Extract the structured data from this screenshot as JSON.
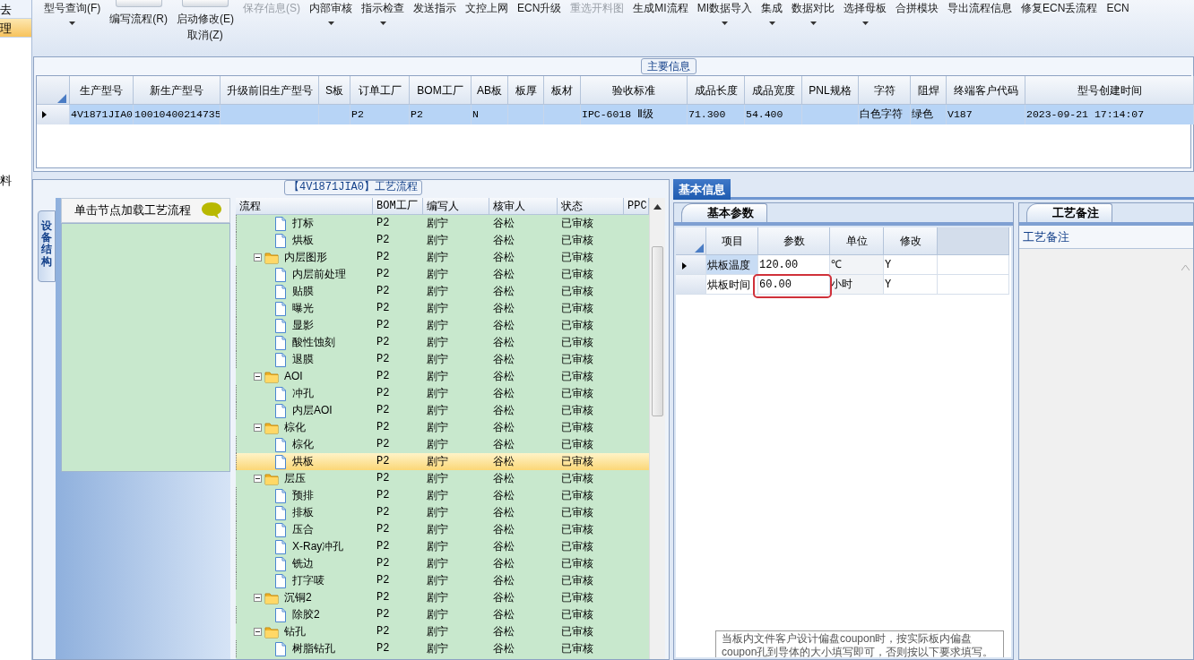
{
  "left_nav": {
    "items": [
      {
        "label": "去",
        "selected": false
      },
      {
        "label": "理",
        "selected": true
      }
    ],
    "side_labels": [
      "料"
    ]
  },
  "toolbar": {
    "items": [
      {
        "label": "型号查询(F)",
        "kind": "small",
        "dropdown": true,
        "disabled": false
      },
      {
        "label": "编写流程(R)",
        "kind": "large",
        "dropdown": false,
        "disabled": false
      },
      {
        "label": "启动修改(E)",
        "label2": "取消(Z)",
        "kind": "large",
        "dropdown": false,
        "disabled": false
      },
      {
        "label": "保存信息(S)",
        "kind": "small",
        "dropdown": false,
        "disabled": true
      },
      {
        "label": "内部审核",
        "kind": "small",
        "dropdown": true,
        "disabled": false
      },
      {
        "label": "指示检查",
        "kind": "small",
        "dropdown": true,
        "disabled": false
      },
      {
        "label": "发送指示",
        "kind": "small",
        "dropdown": false,
        "disabled": false
      },
      {
        "label": "文控上网",
        "kind": "small",
        "dropdown": false,
        "disabled": false
      },
      {
        "label": "ECN升级",
        "kind": "small",
        "dropdown": false,
        "disabled": false
      },
      {
        "label": "重选开料图",
        "kind": "small",
        "dropdown": false,
        "disabled": true
      },
      {
        "label": "生成MI流程",
        "kind": "small",
        "dropdown": false,
        "disabled": false
      },
      {
        "label": "MI数据导入",
        "kind": "small",
        "dropdown": true,
        "disabled": false
      },
      {
        "label": "集成",
        "kind": "small",
        "dropdown": true,
        "disabled": false
      },
      {
        "label": "数据对比",
        "kind": "small",
        "dropdown": true,
        "disabled": false
      },
      {
        "label": "选择母板",
        "kind": "small",
        "dropdown": true,
        "disabled": false
      },
      {
        "label": "合拼模块",
        "kind": "small",
        "dropdown": false,
        "disabled": false
      },
      {
        "label": "导出流程信息",
        "kind": "small",
        "dropdown": false,
        "disabled": false
      },
      {
        "label": "修复ECN丢流程",
        "kind": "small",
        "dropdown": false,
        "disabled": false
      },
      {
        "label": "ECN",
        "kind": "small",
        "dropdown": false,
        "disabled": false
      }
    ]
  },
  "main_info": {
    "title": "主要信息",
    "columns": [
      "生产型号",
      "新生产型号",
      "升级前旧生产型号",
      "S板",
      "订单工厂",
      "BOM工厂",
      "AB板",
      "板厚",
      "板材",
      "验收标准",
      "成品长度",
      "成品宽度",
      "PNL规格",
      "字符",
      "阻焊",
      "终端客户代码",
      "型号创建时间"
    ],
    "rows": [
      {
        "selected": true,
        "cells": [
          "4V1871JIA0",
          "10010400214735",
          null,
          null,
          "P2",
          "P2",
          "N",
          null,
          null,
          "IPC-6018 Ⅱ级",
          "71.300",
          "54.400",
          null,
          "白色字符",
          "绿色",
          "V187",
          "2023-09-21 17:14:07"
        ]
      }
    ]
  },
  "flow_panel": {
    "title": "【4V1871JIA0】工艺流程",
    "side_tab": "设备结构",
    "hint": "单击节点加载工艺流程",
    "columns": [
      "流程",
      "BOM工厂",
      "编写人",
      "核审人",
      "状态",
      "PPC"
    ],
    "tree": [
      {
        "kind": "file",
        "label": "打标",
        "bom": "P2",
        "writer": "剧宁",
        "reviewer": "谷松",
        "status": "已审核",
        "selected": false
      },
      {
        "kind": "file",
        "label": "烘板",
        "bom": "P2",
        "writer": "剧宁",
        "reviewer": "谷松",
        "status": "已审核",
        "selected": false
      },
      {
        "kind": "folder",
        "label": "内层图形",
        "bom": "P2",
        "writer": "剧宁",
        "reviewer": "谷松",
        "status": "已审核",
        "selected": false,
        "expanded": true,
        "children": [
          {
            "kind": "file",
            "label": "内层前处理",
            "bom": "P2",
            "writer": "剧宁",
            "reviewer": "谷松",
            "status": "已审核",
            "selected": false
          },
          {
            "kind": "file",
            "label": "贴膜",
            "bom": "P2",
            "writer": "剧宁",
            "reviewer": "谷松",
            "status": "已审核",
            "selected": false
          },
          {
            "kind": "file",
            "label": "曝光",
            "bom": "P2",
            "writer": "剧宁",
            "reviewer": "谷松",
            "status": "已审核",
            "selected": false
          },
          {
            "kind": "file",
            "label": "显影",
            "bom": "P2",
            "writer": "剧宁",
            "reviewer": "谷松",
            "status": "已审核",
            "selected": false
          },
          {
            "kind": "file",
            "label": "酸性蚀刻",
            "bom": "P2",
            "writer": "剧宁",
            "reviewer": "谷松",
            "status": "已审核",
            "selected": false
          },
          {
            "kind": "file",
            "label": "退膜",
            "bom": "P2",
            "writer": "剧宁",
            "reviewer": "谷松",
            "status": "已审核",
            "selected": false
          }
        ]
      },
      {
        "kind": "folder",
        "label": "AOI",
        "bom": "P2",
        "writer": "剧宁",
        "reviewer": "谷松",
        "status": "已审核",
        "selected": false,
        "expanded": true,
        "children": [
          {
            "kind": "file",
            "label": "冲孔",
            "bom": "P2",
            "writer": "剧宁",
            "reviewer": "谷松",
            "status": "已审核",
            "selected": false
          },
          {
            "kind": "file",
            "label": "内层AOI",
            "bom": "P2",
            "writer": "剧宁",
            "reviewer": "谷松",
            "status": "已审核",
            "selected": false
          }
        ]
      },
      {
        "kind": "folder",
        "label": "棕化",
        "bom": "P2",
        "writer": "剧宁",
        "reviewer": "谷松",
        "status": "已审核",
        "selected": false,
        "expanded": true,
        "children": [
          {
            "kind": "file",
            "label": "棕化",
            "bom": "P2",
            "writer": "剧宁",
            "reviewer": "谷松",
            "status": "已审核",
            "selected": false
          },
          {
            "kind": "file",
            "label": "烘板",
            "bom": "P2",
            "writer": "剧宁",
            "reviewer": "谷松",
            "status": "已审核",
            "selected": true
          }
        ]
      },
      {
        "kind": "folder",
        "label": "层压",
        "bom": "P2",
        "writer": "剧宁",
        "reviewer": "谷松",
        "status": "已审核",
        "selected": false,
        "expanded": true,
        "children": [
          {
            "kind": "file",
            "label": "预排",
            "bom": "P2",
            "writer": "剧宁",
            "reviewer": "谷松",
            "status": "已审核",
            "selected": false
          },
          {
            "kind": "file",
            "label": "排板",
            "bom": "P2",
            "writer": "剧宁",
            "reviewer": "谷松",
            "status": "已审核",
            "selected": false
          },
          {
            "kind": "file",
            "label": "压合",
            "bom": "P2",
            "writer": "剧宁",
            "reviewer": "谷松",
            "status": "已审核",
            "selected": false
          },
          {
            "kind": "file",
            "label": "X-Ray冲孔",
            "bom": "P2",
            "writer": "剧宁",
            "reviewer": "谷松",
            "status": "已审核",
            "selected": false
          },
          {
            "kind": "file",
            "label": "铣边",
            "bom": "P2",
            "writer": "剧宁",
            "reviewer": "谷松",
            "status": "已审核",
            "selected": false
          },
          {
            "kind": "file",
            "label": "打字唛",
            "bom": "P2",
            "writer": "剧宁",
            "reviewer": "谷松",
            "status": "已审核",
            "selected": false
          }
        ]
      },
      {
        "kind": "folder",
        "label": "沉铜2",
        "bom": "P2",
        "writer": "剧宁",
        "reviewer": "谷松",
        "status": "已审核",
        "selected": false,
        "expanded": true,
        "children": [
          {
            "kind": "file",
            "label": "除胶2",
            "bom": "P2",
            "writer": "剧宁",
            "reviewer": "谷松",
            "status": "已审核",
            "selected": false
          }
        ]
      },
      {
        "kind": "folder",
        "label": "钻孔",
        "bom": "P2",
        "writer": "剧宁",
        "reviewer": "谷松",
        "status": "已审核",
        "selected": false,
        "expanded": true,
        "children": [
          {
            "kind": "file",
            "label": "树脂钻孔",
            "bom": "P2",
            "writer": "剧宁",
            "reviewer": "谷松",
            "status": "已审核",
            "selected": false
          }
        ]
      }
    ]
  },
  "detail_tabs": [
    {
      "label": "基本信息",
      "selected": true
    }
  ],
  "params": {
    "tab": "基本参数",
    "columns": [
      "项目",
      "参数",
      "单位",
      "修改"
    ],
    "rows": [
      {
        "current": true,
        "highlighted": false,
        "cells": [
          "烘板温度",
          "120.00",
          "℃",
          "Y"
        ]
      },
      {
        "current": false,
        "highlighted": true,
        "cells": [
          "烘板时间",
          "60.00",
          "小时",
          "Y"
        ]
      }
    ],
    "note": "当板内文件客户设计偏盘coupon时，按实际板内偏盘coupon孔到导体的大小填写即可，否则按以下要求填写。"
  },
  "remarks": {
    "tab": "工艺备注",
    "label": "工艺备注"
  }
}
